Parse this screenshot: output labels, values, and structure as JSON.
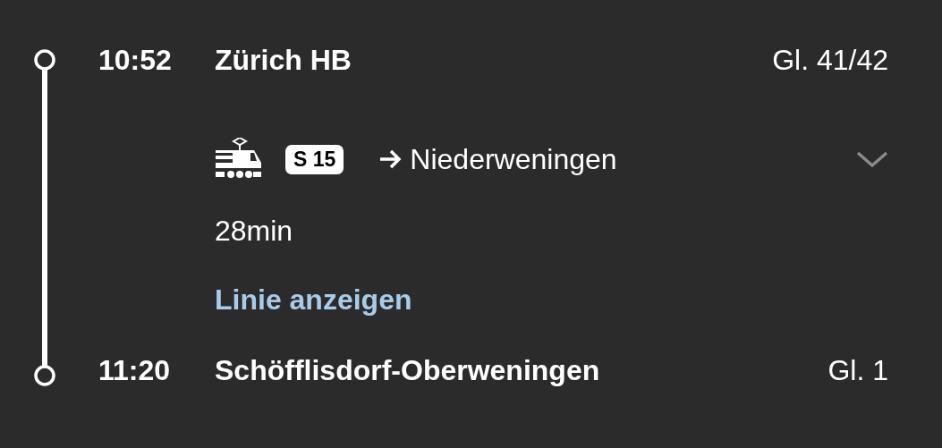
{
  "stops": [
    {
      "time": "10:52",
      "station": "Zürich HB",
      "platform": "Gl. 41/42"
    },
    {
      "time": "11:20",
      "station": "Schöfflisdorf-Oberweningen",
      "platform": "Gl. 1"
    }
  ],
  "leg": {
    "line": "S 15",
    "direction": "Niederweningen",
    "duration": "28min",
    "link": "Linie anzeigen",
    "expanded": false
  }
}
